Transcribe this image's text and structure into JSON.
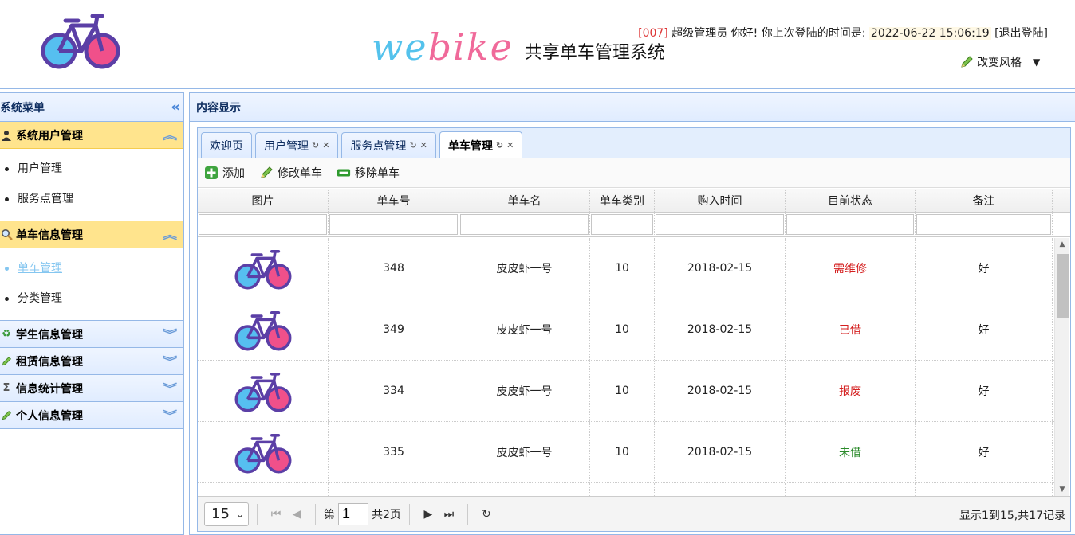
{
  "header": {
    "brand_we": "we",
    "brand_bike": "bike",
    "brand_sub": "共享单车管理系统",
    "welcome_id": "[007]",
    "welcome_text": " 超级管理员 你好! 你上次登陆的时间是: ",
    "last_login": "2022-06-22 15:06:19",
    "logout": "[退出登陆]",
    "theme_label": "改变风格"
  },
  "sidebar": {
    "title": "系统菜单",
    "sections": [
      {
        "label": "系统用户管理",
        "icon": "user-icon",
        "state": "open",
        "items": [
          "用户管理",
          "服务点管理"
        ]
      },
      {
        "label": "单车信息管理",
        "icon": "search-icon",
        "state": "open",
        "items": [
          "单车管理",
          "分类管理"
        ],
        "active_item": "单车管理"
      },
      {
        "label": "学生信息管理",
        "icon": "refresh-icon",
        "state": "closed"
      },
      {
        "label": "租赁信息管理",
        "icon": "pencil-icon",
        "state": "closed"
      },
      {
        "label": "信息统计管理",
        "icon": "sigma-icon",
        "state": "closed"
      },
      {
        "label": "个人信息管理",
        "icon": "pencil-icon",
        "state": "closed"
      }
    ]
  },
  "content": {
    "title": "内容显示",
    "tabs": [
      {
        "label": "欢迎页",
        "closable": false
      },
      {
        "label": "用户管理",
        "closable": true
      },
      {
        "label": "服务点管理",
        "closable": true
      },
      {
        "label": "单车管理",
        "closable": true,
        "active": true
      }
    ],
    "toolbar": {
      "add": "添加",
      "edit": "修改单车",
      "remove": "移除单车"
    },
    "grid": {
      "columns": [
        "图片",
        "单车号",
        "单车名",
        "单车类别",
        "购入时间",
        "目前状态",
        "备注"
      ],
      "rows": [
        {
          "id": "348",
          "name": "皮皮虾一号",
          "category": "10",
          "date": "2018-02-15",
          "status": "需维修",
          "note": "好"
        },
        {
          "id": "349",
          "name": "皮皮虾一号",
          "category": "10",
          "date": "2018-02-15",
          "status": "已借",
          "note": "好"
        },
        {
          "id": "334",
          "name": "皮皮虾一号",
          "category": "10",
          "date": "2018-02-15",
          "status": "报废",
          "note": "好"
        },
        {
          "id": "335",
          "name": "皮皮虾一号",
          "category": "10",
          "date": "2018-02-15",
          "status": "未借",
          "note": "好"
        }
      ]
    },
    "pager": {
      "page_size": "15",
      "page_prefix": "第",
      "page_value": "1",
      "page_total": "共2页",
      "info": "显示1到15,共17记录"
    }
  },
  "colors": {
    "accent": "#95b8e7",
    "open_section": "#ffe48d",
    "status_red": "#d42020",
    "status_green": "#2a8a2a",
    "brand_blue": "#54c2ec",
    "brand_pink": "#f06a9a"
  }
}
